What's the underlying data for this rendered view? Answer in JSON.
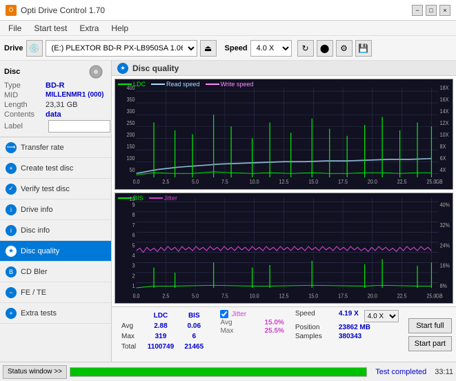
{
  "titlebar": {
    "title": "Opti Drive Control 1.70",
    "minimize": "−",
    "maximize": "□",
    "close": "×"
  },
  "menubar": {
    "items": [
      "File",
      "Start test",
      "Extra",
      "Help"
    ]
  },
  "toolbar": {
    "drive_label": "Drive",
    "drive_value": "(E:) PLEXTOR BD-R  PX-LB950SA 1.06",
    "speed_label": "Speed",
    "speed_value": "4.0 X"
  },
  "disc": {
    "section_label": "Disc",
    "type_label": "Type",
    "type_value": "BD-R",
    "mid_label": "MID",
    "mid_value": "MILLENMR1 (000)",
    "length_label": "Length",
    "length_value": "23,31 GB",
    "contents_label": "Contents",
    "contents_value": "data",
    "label_label": "Label",
    "label_value": ""
  },
  "nav": {
    "items": [
      {
        "id": "transfer-rate",
        "label": "Transfer rate",
        "active": false
      },
      {
        "id": "create-test-disc",
        "label": "Create test disc",
        "active": false
      },
      {
        "id": "verify-test-disc",
        "label": "Verify test disc",
        "active": false
      },
      {
        "id": "drive-info",
        "label": "Drive info",
        "active": false
      },
      {
        "id": "disc-info",
        "label": "Disc info",
        "active": false
      },
      {
        "id": "disc-quality",
        "label": "Disc quality",
        "active": true
      },
      {
        "id": "cd-bler",
        "label": "CD Bler",
        "active": false
      },
      {
        "id": "fe-te",
        "label": "FE / TE",
        "active": false
      },
      {
        "id": "extra-tests",
        "label": "Extra tests",
        "active": false
      }
    ]
  },
  "disc_quality": {
    "title": "Disc quality",
    "legend_top": {
      "ldc": "LDC",
      "read_speed": "Read speed",
      "write_speed": "Write speed"
    },
    "legend_bottom": {
      "bis": "BIS",
      "jitter": "Jitter"
    }
  },
  "stats": {
    "headers": [
      "LDC",
      "BIS"
    ],
    "avg_label": "Avg",
    "avg_ldc": "2.88",
    "avg_bis": "0.06",
    "max_label": "Max",
    "max_ldc": "319",
    "max_bis": "6",
    "total_label": "Total",
    "total_ldc": "1100749",
    "total_bis": "21465",
    "jitter_label": "Jitter",
    "jitter_avg": "15.0%",
    "jitter_max": "25.5%",
    "speed_label": "Speed",
    "speed_val": "4.19 X",
    "speed_select": "4.0 X",
    "position_label": "Position",
    "position_val": "23862 MB",
    "samples_label": "Samples",
    "samples_val": "380343"
  },
  "buttons": {
    "start_full": "Start full",
    "start_part": "Start part"
  },
  "statusbar": {
    "status_window": "Status window >>",
    "progress_pct": 100,
    "status_text": "Test completed",
    "time_text": "33:11"
  },
  "colors": {
    "ldc_line": "#00cc00",
    "bis_line": "#00cc00",
    "read_speed": "#aaddff",
    "jitter_line": "#cc44cc",
    "chart_bg": "#111122",
    "grid": "#333355",
    "accent_blue": "#0000cc"
  }
}
